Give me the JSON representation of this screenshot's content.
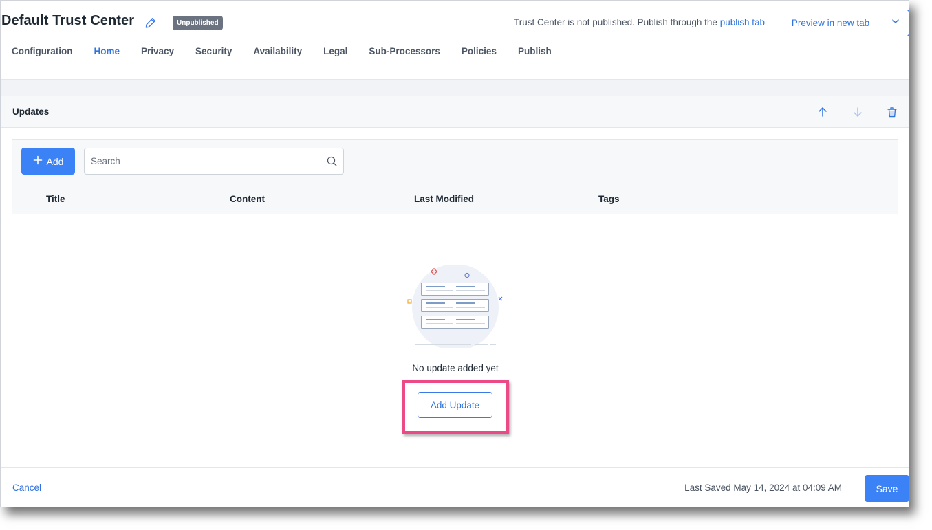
{
  "header": {
    "title": "Default Trust Center",
    "status_badge": "Unpublished",
    "publish_note_text": "Trust Center is not published. Publish through the ",
    "publish_note_link": "publish tab",
    "preview_button": "Preview in new tab"
  },
  "tabs": [
    {
      "label": "Configuration"
    },
    {
      "label": "Home",
      "active": true
    },
    {
      "label": "Privacy"
    },
    {
      "label": "Security"
    },
    {
      "label": "Availability"
    },
    {
      "label": "Legal"
    },
    {
      "label": "Sub-Processors"
    },
    {
      "label": "Policies"
    },
    {
      "label": "Publish"
    }
  ],
  "section": {
    "title": "Updates",
    "icons": [
      "arrow-up-icon",
      "arrow-down-icon",
      "trash-icon"
    ]
  },
  "toolbar": {
    "add_label": "Add",
    "search_placeholder": "Search"
  },
  "table": {
    "columns": [
      "Title",
      "Content",
      "Last Modified",
      "Tags"
    ]
  },
  "empty_state": {
    "message": "No update added yet",
    "button_label": "Add Update"
  },
  "footer": {
    "cancel_label": "Cancel",
    "last_saved": "Last Saved May 14, 2024 at 04:09 AM",
    "save_label": "Save"
  },
  "colors": {
    "accent": "#2f73e0",
    "primary_button": "#3b82f6",
    "badge": "#6b7280",
    "highlight": "#ec4a86"
  }
}
